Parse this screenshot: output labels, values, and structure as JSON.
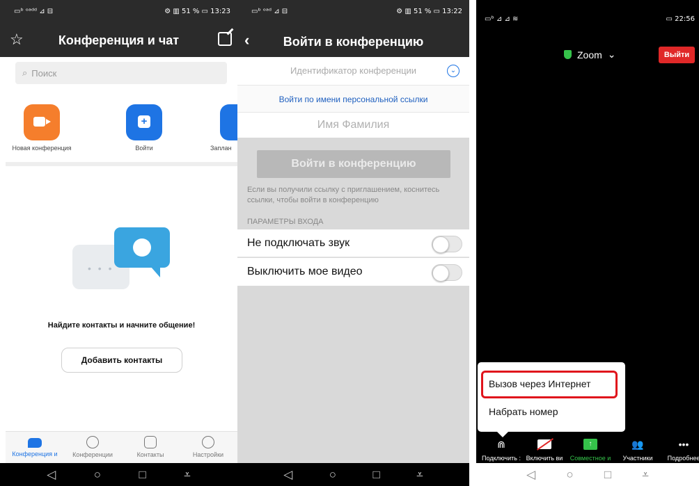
{
  "panel1": {
    "status": {
      "left": "▭ᵇ ᵒᵃᵈᵈ ⊿ ⊟",
      "right": "⚙ ▥ 51 % ▭ 13:23"
    },
    "title": "Конференция и чат",
    "search_placeholder": "Поиск",
    "actions": [
      {
        "label": "Новая конференция"
      },
      {
        "label": "Войти"
      },
      {
        "label": "Заплан"
      }
    ],
    "empty_text": "Найдите контакты и начните общение!",
    "add_contacts": "Добавить контакты",
    "tabs": [
      {
        "label": "Конференция и"
      },
      {
        "label": "Конференции"
      },
      {
        "label": "Контакты"
      },
      {
        "label": "Настройки"
      }
    ],
    "nav": {
      "back": "◁",
      "home": "○",
      "recent": "□",
      "menu": "⩡"
    }
  },
  "panel2": {
    "status": {
      "left": "▭ᵇ ᵒᵃᵈ ⊿ ⊟",
      "right": "⚙ ▥ 51 % ▭ 13:22"
    },
    "title": "Войти в конференцию",
    "meeting_id_placeholder": "Идентификатор конференции",
    "personal_link": "Войти по имени персональной ссылки",
    "name_placeholder": "Имя Фамилия",
    "join_button": "Войти в конференцию",
    "hint": "Если вы получили ссылку с приглашением, коснитесь ссылки, чтобы войти в конференцию",
    "section": "ПАРАМЕТРЫ ВХОДА",
    "options": [
      {
        "label": "Не подключать звук"
      },
      {
        "label": "Выключить мое видео"
      }
    ],
    "nav": {
      "back": "◁",
      "home": "○",
      "recent": "□",
      "menu": "⩡"
    }
  },
  "panel3": {
    "status": {
      "left": "▭ᵇ ⊿ ⊿ ≋",
      "right": "▭ 22:56"
    },
    "meeting_name": "Zoom",
    "leave": "Выйти",
    "popup": {
      "internet": "Вызов через Интернет",
      "dial": "Набрать номер"
    },
    "toolbar": [
      {
        "label": "Подключить :"
      },
      {
        "label": "Включить ви"
      },
      {
        "label": "Совместное и"
      },
      {
        "label": "Участники"
      },
      {
        "label": "Подробнее"
      }
    ],
    "nav": {
      "back": "◁",
      "home": "○",
      "recent": "□",
      "menu": "⩡"
    }
  },
  "colors": {
    "zoom_blue": "#1e74e4",
    "orange": "#f57e2c",
    "red": "#e02828",
    "green": "#35c24a"
  }
}
